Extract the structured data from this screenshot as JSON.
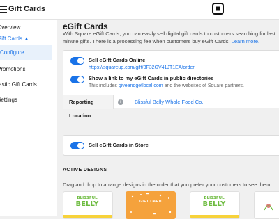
{
  "header": {
    "app_title": "Gift Cards",
    "logo_icon": "square-logo-icon"
  },
  "sidebar": {
    "items": [
      {
        "label": "Overview"
      },
      {
        "label": "Gift Cards"
      },
      {
        "label": "Configure"
      },
      {
        "label": "Promotions"
      },
      {
        "label": "Plastic Gift Cards"
      },
      {
        "label": "Settings"
      }
    ]
  },
  "main": {
    "title": "eGift Cards",
    "intro_text": "With Square eGift Cards, you can easily sell digital gift cards to customers searching for last minute gifts. There is a processing fee when customers buy eGift Cards.",
    "learn_more": "Learn more.",
    "sell_online": {
      "title": "Sell eGift Cards Online",
      "url": "https://squareup.com/gift/3F32GV41JT1EA/order",
      "enabled": true
    },
    "directory": {
      "title": "Show a link to my eGift Cards in public directories",
      "desc_prefix": "This includes",
      "desc_link": "giveandgetlocal.com",
      "desc_suffix": "and the websites of Square partners.",
      "enabled": true
    },
    "reporting": {
      "label": "Reporting Location",
      "value": "Blissful Belly Whole Food Co."
    },
    "in_store": {
      "title": "Sell eGift Cards in Store",
      "enabled": true
    },
    "active_designs": {
      "heading": "ACTIVE DESIGNS",
      "description": "Drag and drop to arrange designs in the order that you prefer your customers to see them.",
      "designs": [
        {
          "line1": "BLISSFUL",
          "line2": "BELLY"
        },
        {
          "label": "GIFT CARD"
        },
        {
          "line1": "BLISSFUL",
          "line2": "BELLY"
        }
      ]
    }
  },
  "colors": {
    "accent": "#1a73e8",
    "brand_green": "#6dbb3f",
    "design_orange": "#f5a23c"
  }
}
